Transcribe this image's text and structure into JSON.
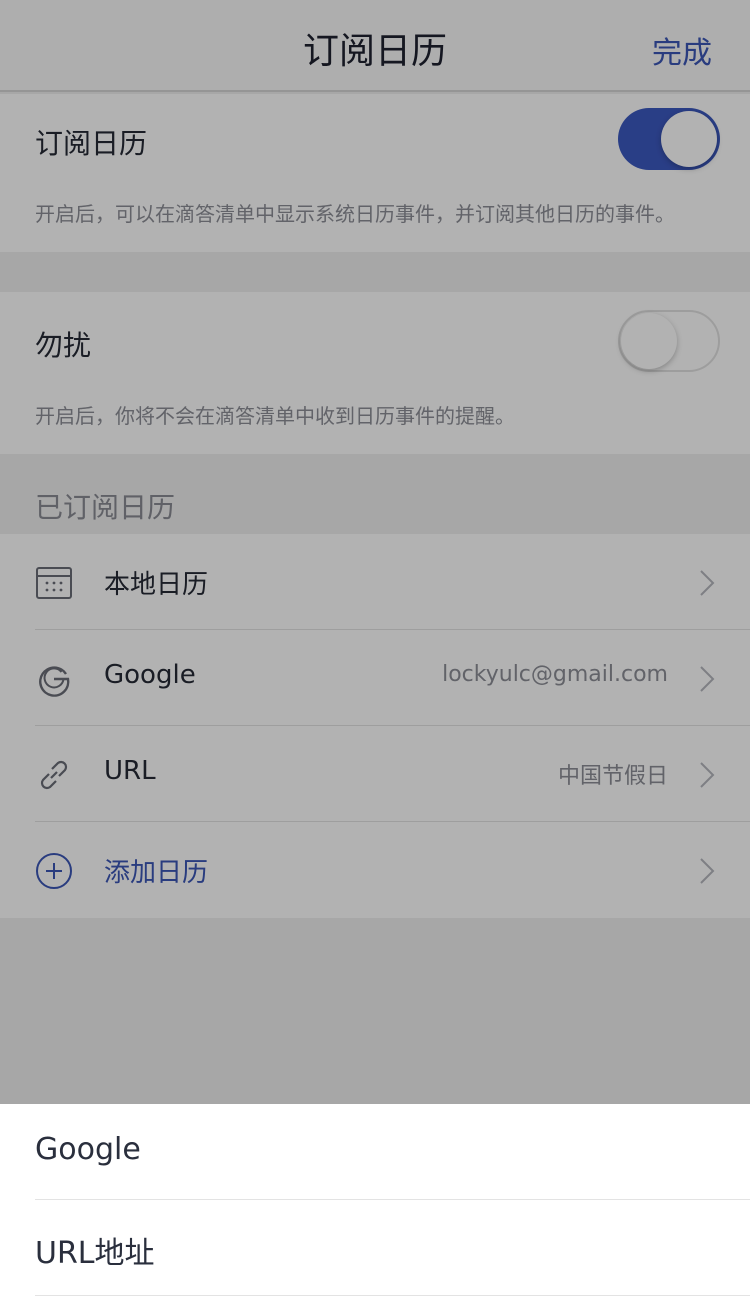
{
  "header": {
    "title": "订阅日历",
    "done_label": "完成"
  },
  "subscribe": {
    "title": "订阅日历",
    "description": "开启后，可以在滴答清单中显示系统日历事件，并订阅其他日历的事件。",
    "enabled": true
  },
  "dnd": {
    "title": "勿扰",
    "description": "开启后，你将不会在滴答清单中收到日历事件的提醒。",
    "enabled": false
  },
  "subscribed_section": {
    "label": "已订阅日历"
  },
  "calendars": [
    {
      "label": "本地日历",
      "value": "",
      "icon": "calendar-icon"
    },
    {
      "label": "Google",
      "value": "lockyulc@gmail.com",
      "icon": "google-icon"
    },
    {
      "label": "URL",
      "value": "中国节假日",
      "icon": "link-icon"
    },
    {
      "label": "添加日历",
      "value": "",
      "icon": "plus-circle-icon"
    }
  ],
  "action_sheet": {
    "items": [
      {
        "label": "Google"
      },
      {
        "label": "URL地址"
      }
    ]
  },
  "colors": {
    "accent": "#3c59c0",
    "link": "#3b56b6"
  }
}
